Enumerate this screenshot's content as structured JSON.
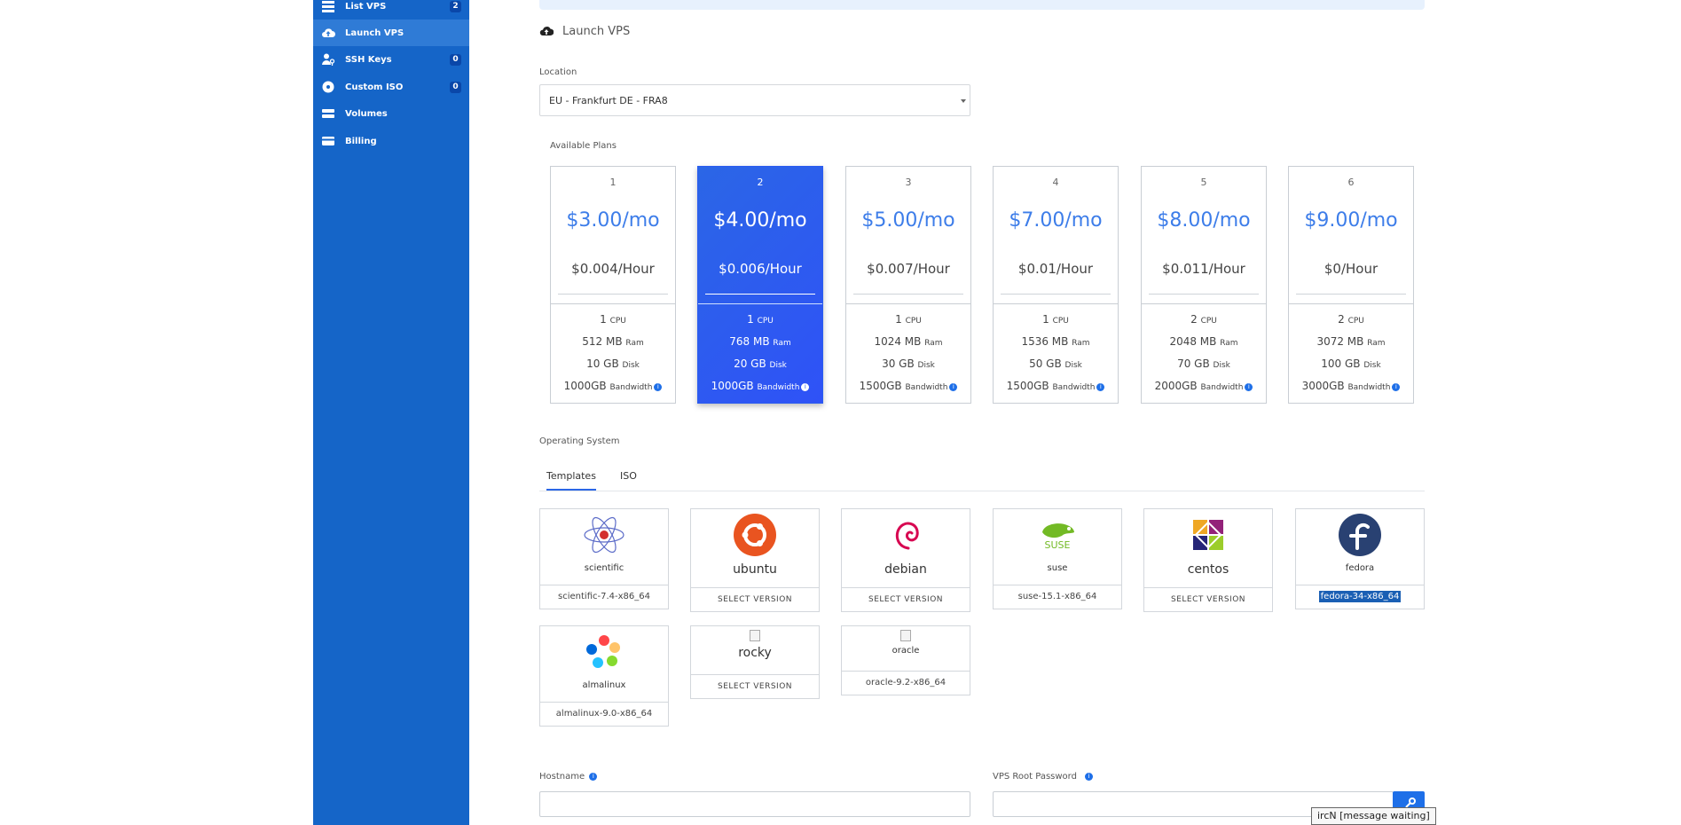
{
  "sidebar": {
    "items": [
      {
        "label": "List VPS",
        "badge": "2",
        "icon": "server-list-icon"
      },
      {
        "label": "Launch VPS",
        "badge": "",
        "icon": "cloud-upload-icon"
      },
      {
        "label": "SSH Keys",
        "badge": "0",
        "icon": "user-key-icon"
      },
      {
        "label": "Custom ISO",
        "badge": "0",
        "icon": "disc-icon"
      },
      {
        "label": "Volumes",
        "badge": "",
        "icon": "volumes-stack-icon"
      },
      {
        "label": "Billing",
        "badge": "",
        "icon": "credit-card-icon"
      }
    ]
  },
  "page": {
    "title": "Launch VPS",
    "location_label": "Location",
    "location_value": "EU - Frankfurt DE - FRA8",
    "plans_label": "Available Plans",
    "os_label": "Operating System",
    "hostname_label": "Hostname",
    "password_label": "VPS Root Password"
  },
  "plans": [
    {
      "num": "1",
      "price": "$3.00/mo",
      "hour": "$0.004/Hour",
      "cpu": "1",
      "ram": "512 MB",
      "disk": "10 GB",
      "bandwidth": "1000GB"
    },
    {
      "num": "2",
      "price": "$4.00/mo",
      "hour": "$0.006/Hour",
      "cpu": "1",
      "ram": "768 MB",
      "disk": "20 GB",
      "bandwidth": "1000GB"
    },
    {
      "num": "3",
      "price": "$5.00/mo",
      "hour": "$0.007/Hour",
      "cpu": "1",
      "ram": "1024 MB",
      "disk": "30 GB",
      "bandwidth": "1500GB"
    },
    {
      "num": "4",
      "price": "$7.00/mo",
      "hour": "$0.01/Hour",
      "cpu": "1",
      "ram": "1536 MB",
      "disk": "50 GB",
      "bandwidth": "1500GB"
    },
    {
      "num": "5",
      "price": "$8.00/mo",
      "hour": "$0.011/Hour",
      "cpu": "2",
      "ram": "2048 MB",
      "disk": "70 GB",
      "bandwidth": "2000GB"
    },
    {
      "num": "6",
      "price": "$9.00/mo",
      "hour": "$0/Hour",
      "cpu": "2",
      "ram": "3072 MB",
      "disk": "100 GB",
      "bandwidth": "3000GB"
    }
  ],
  "spec_units": {
    "cpu": "CPU",
    "ram": "Ram",
    "disk": "Disk",
    "bandwidth": "Bandwidth"
  },
  "tabs": [
    "Templates",
    "ISO"
  ],
  "os": [
    {
      "name": "scientific",
      "foot": "scientific-7.4-x86_64"
    },
    {
      "name": "ubuntu",
      "foot": "SELECT VERSION"
    },
    {
      "name": "debian",
      "foot": "SELECT VERSION"
    },
    {
      "name": "suse",
      "foot": "suse-15.1-x86_64"
    },
    {
      "name": "centos",
      "foot": "SELECT VERSION"
    },
    {
      "name": "fedora",
      "foot": "fedora-34-x86_64"
    },
    {
      "name": "almalinux",
      "foot": "almalinux-9.0-x86_64"
    },
    {
      "name": "rocky",
      "foot": "SELECT VERSION"
    },
    {
      "name": "oracle",
      "foot": "oracle-9.2-x86_64"
    }
  ],
  "tooltip": "ircN [message waiting]",
  "colors": {
    "sidebar": "#1565c8",
    "accent": "#2b66e6",
    "price": "#3d7de9"
  }
}
